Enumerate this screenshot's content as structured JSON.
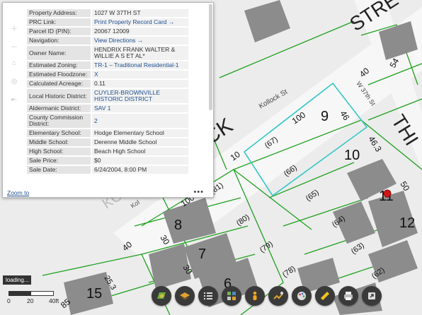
{
  "parcel_labels": [
    "9",
    "10",
    "11",
    "12",
    "8",
    "7",
    "6",
    "15",
    "46",
    "46.3",
    "100",
    "10",
    "100",
    "30",
    "30",
    "40",
    "40",
    "50",
    "54",
    "25.3",
    "85",
    "30",
    "(67)",
    "(66)",
    "(65)",
    "(64)",
    "(63)",
    "(62)",
    "(81)",
    "(80)",
    "(79)",
    "(78)"
  ],
  "street_labels": {
    "kollock_st": "Kollock St",
    "w37th": "W 37th St",
    "kollock_big": "KOLLOCK",
    "kollock_faint": "KOLLOCK",
    "kol_small": "Kol",
    "street_big": "STRE",
    "thi_big": "THI"
  },
  "popup": {
    "rows": [
      {
        "label": "Property Address:",
        "value": "1027 W 37TH ST",
        "link": false
      },
      {
        "label": "PRC Link:",
        "value": "Print Property Record Card →",
        "link": true
      },
      {
        "label": "Parcel ID (PIN):",
        "value": "20067 12009",
        "link": false
      },
      {
        "label": "Navigation:",
        "value": "View Directions →",
        "link": true
      },
      {
        "label": "Owner Name:",
        "value": "HENDRIX FRANK WALTER & WILLIE A S ET AL*",
        "link": false
      },
      {
        "label": "Estimated Zoning:",
        "value": "TR-1 – Traditional Residential-1",
        "link": true
      },
      {
        "label": "Estimated Floodzone:",
        "value": "X",
        "link": false
      },
      {
        "label": "Calculated Acreage:",
        "value": "0.11",
        "link": false
      },
      {
        "label": "Local Historic District:",
        "value": "CUYLER-BROWNVILLE HISTORIC DISTRICT",
        "link": true
      },
      {
        "label": "Aldermanic District:",
        "value": "SAV 1",
        "link": false
      },
      {
        "label": "County Commission District:",
        "value": "2",
        "link": false
      },
      {
        "label": "Elementary School:",
        "value": "Hodge Elementary School",
        "link": false
      },
      {
        "label": "Middle School:",
        "value": "Derenne Middle School",
        "link": false
      },
      {
        "label": "High School:",
        "value": "Beach High School",
        "link": false
      },
      {
        "label": "Sale Price:",
        "value": "$0",
        "link": false
      },
      {
        "label": "Sale Date:",
        "value": "6/24/2004, 8:00 PM",
        "link": false
      }
    ],
    "zoom_to": "Zoom to",
    "more": "•••"
  },
  "status": {
    "loading": "loading..."
  },
  "scale": {
    "labels": [
      "0",
      "20",
      "40ft"
    ]
  },
  "toolbar": {
    "tools": [
      {
        "name": "basemap-tool",
        "icon": "map-icon"
      },
      {
        "name": "layers-tool",
        "icon": "layers-icon"
      },
      {
        "name": "legend-tool",
        "icon": "list-icon"
      },
      {
        "name": "widgets-tool",
        "icon": "grid-icon"
      },
      {
        "name": "street-view-tool",
        "icon": "pegman-icon"
      },
      {
        "name": "draw-tool",
        "icon": "draw-icon"
      },
      {
        "name": "palette-tool",
        "icon": "palette-icon"
      },
      {
        "name": "measure-tool",
        "icon": "ruler-icon"
      },
      {
        "name": "print-tool",
        "icon": "print-icon"
      },
      {
        "name": "share-tool",
        "icon": "share-icon"
      }
    ]
  },
  "colors": {
    "parcel_line": "#1fa01f",
    "selected_outline": "#33c6c6",
    "road": "#f9f9f9",
    "building": "#8a8a8a",
    "marker": "#d01818",
    "toolbar_bg": "#3a3a3a"
  }
}
